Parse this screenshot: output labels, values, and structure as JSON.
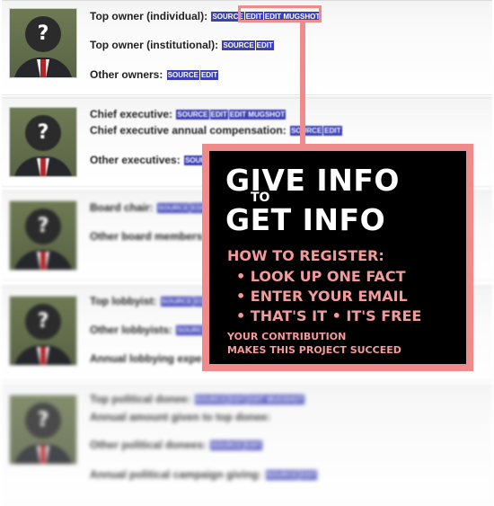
{
  "tags": {
    "source": "SOURCE",
    "edit": "EDIT",
    "edit_mugshot": "EDIT MUGSHOT"
  },
  "portrait_glyph": "?",
  "cards": {
    "owners": {
      "top_individual": "Top owner (individual):",
      "top_institutional": "Top owner (institutional):",
      "other": "Other owners:"
    },
    "executives": {
      "chief": "Chief executive:",
      "compensation": "Chief executive annual compensation:",
      "other": "Other executives:"
    },
    "board": {
      "chair": "Board chair:",
      "members": "Other board members:"
    },
    "lobbyists": {
      "top": "Top lobbyist:",
      "other": "Other lobbyists:",
      "expense": "Annual lobbying expe"
    },
    "political": {
      "top_donee": "Top political donee:",
      "amount": "Annual amount given to top donee:",
      "other_donees": "Other political donees:",
      "giving": "Annual political campaign giving:"
    }
  },
  "promo": {
    "line1": "GIVE INFO",
    "to": "TO",
    "line2": "GET INFO",
    "how": "HOW TO REGISTER:",
    "step1": "• LOOK UP ONE FACT",
    "step2": "• ENTER YOUR EMAIL",
    "step3": "• THAT'S IT • IT'S FREE",
    "footer1": "YOUR CONTRIBUTION",
    "footer2": "MAKES THIS PROJECT SUCCEED"
  },
  "colors": {
    "tag_bg": "#3b40b6",
    "callout": "#ef8b8b",
    "promo_text": "#f59a9a"
  }
}
